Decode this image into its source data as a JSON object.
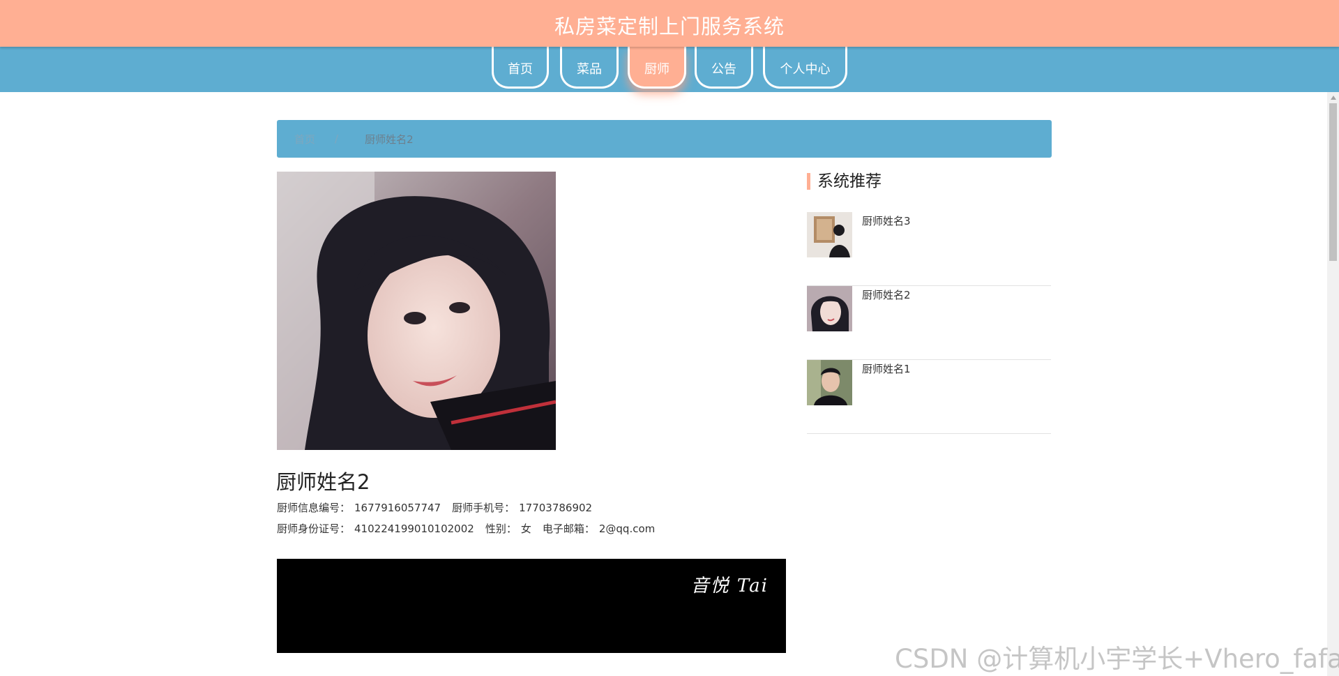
{
  "header": {
    "title": "私房菜定制上门服务系统"
  },
  "nav": {
    "items": [
      {
        "label": "首页"
      },
      {
        "label": "菜品"
      },
      {
        "label": "厨师"
      },
      {
        "label": "公告"
      },
      {
        "label": "个人中心"
      }
    ],
    "active": "厨师"
  },
  "breadcrumb": {
    "home": "首页",
    "separator": "/",
    "current": "厨师姓名2"
  },
  "chef": {
    "name": "厨师姓名2",
    "photo_icon": "portrait-photo",
    "fields": {
      "info_no_label": "厨师信息编号：",
      "info_no": "1677916057747",
      "phone_label": "厨师手机号：",
      "phone": "17703786902",
      "id_card_label": "厨师身份证号：",
      "id_card": "410224199010102002",
      "gender_label": "性别：",
      "gender": "女",
      "email_label": "电子邮箱：",
      "email": "2@qq.com"
    }
  },
  "video": {
    "watermark": "音悦 Tai"
  },
  "recommend": {
    "title": "系统推荐",
    "items": [
      {
        "name": "厨师姓名3"
      },
      {
        "name": "厨师姓名2"
      },
      {
        "name": "厨师姓名1"
      }
    ]
  },
  "watermark": {
    "text": "CSDN @计算机小宇学长+Vhero_fafafa"
  },
  "colors": {
    "header_bg": "#ffaf93",
    "nav_bg": "#5eadd1",
    "accent": "#ffaf93"
  }
}
